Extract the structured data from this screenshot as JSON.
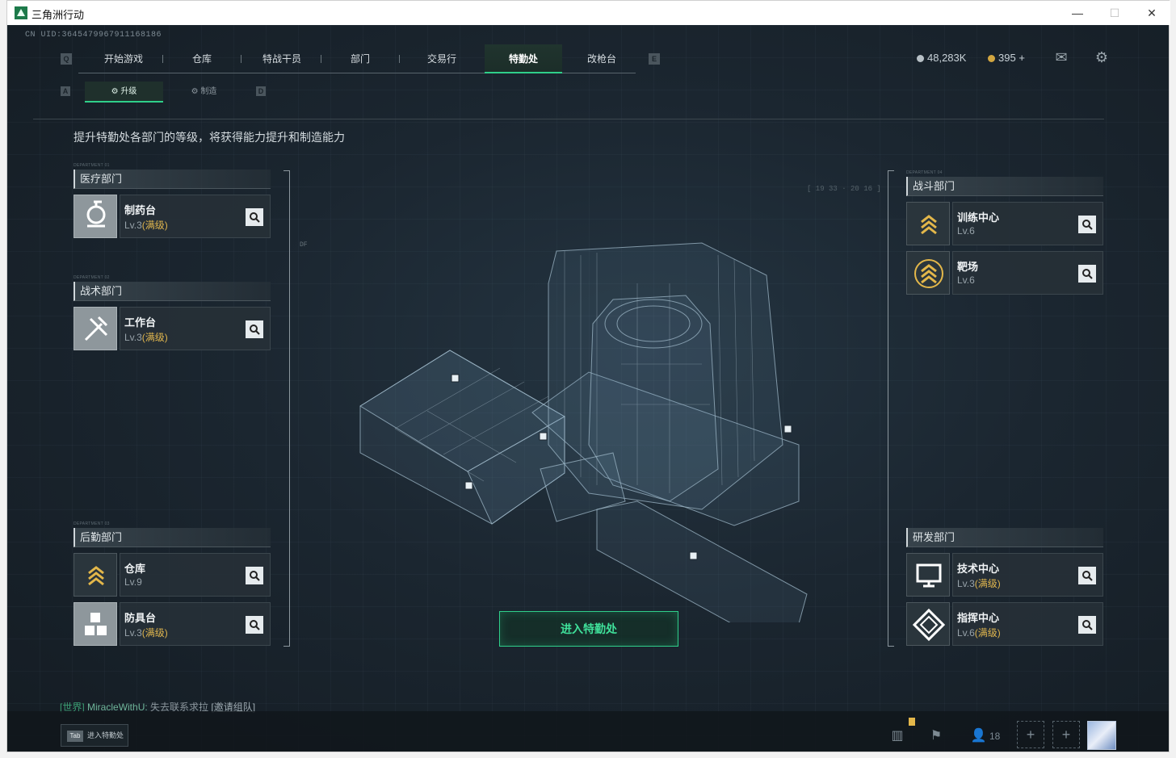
{
  "window": {
    "title": "三角洲行动",
    "minimize": "—",
    "maximize": "☐",
    "close": "✕"
  },
  "uid": "CN UID:3645479967911168186",
  "nav": {
    "key_left": "Q",
    "key_right": "E",
    "tabs": [
      "开始游戏",
      "仓库",
      "特战干员",
      "部门",
      "交易行",
      "特勤处",
      "改枪台"
    ],
    "active": "特勤处"
  },
  "currency": {
    "coins": "48,283K",
    "tickets": "395",
    "tickets_add": "+"
  },
  "subtabs": {
    "key_left": "A",
    "key_right": "D",
    "upgrade": "升级",
    "craft": "制造"
  },
  "description": "提升特勤处各部门的等级，将获得能力提升和制造能力",
  "departments": {
    "medical": {
      "tag": "DEPARTMENT 01",
      "title": "医疗部门",
      "items": [
        {
          "name": "制药台",
          "level": "Lv.3",
          "max": "(满级)",
          "icon": "microscope-icon"
        }
      ]
    },
    "tactical": {
      "tag": "DEPARTMENT 02",
      "title": "战术部门",
      "items": [
        {
          "name": "工作台",
          "level": "Lv.3",
          "max": "(满级)",
          "icon": "hammer-icon"
        }
      ]
    },
    "logistics": {
      "tag": "DEPARTMENT 03",
      "title": "后勤部门",
      "items": [
        {
          "name": "仓库",
          "level": "Lv.9",
          "max": "",
          "icon": "chevron-rank-icon"
        },
        {
          "name": "防具台",
          "level": "Lv.3",
          "max": "(满级)",
          "icon": "boxes-icon"
        }
      ]
    },
    "combat": {
      "tag": "DEPARTMENT 04",
      "title": "战斗部门",
      "items": [
        {
          "name": "训练中心",
          "level": "Lv.6",
          "max": "",
          "icon": "rank-up-icon"
        },
        {
          "name": "靶场",
          "level": "Lv.6",
          "max": "",
          "icon": "rank-up-icon"
        }
      ]
    },
    "research": {
      "title": "研发部门",
      "items": [
        {
          "name": "技术中心",
          "level": "Lv.3",
          "max": "(满级)",
          "icon": "monitor-icon"
        },
        {
          "name": "指挥中心",
          "level": "Lv.6",
          "max": "(满级)",
          "icon": "compass-icon"
        }
      ]
    }
  },
  "hud": {
    "coords": "[ 19 33 · 20 16 ]",
    "df": "DF"
  },
  "enter_button": "进入特勤处",
  "chat": {
    "channel": "[世界]",
    "user": "MiracleWithU:",
    "message": "失去联系求拉",
    "link": "[邀请组队]"
  },
  "tab_hint": {
    "key": "Tab",
    "label": "进入特勤处"
  },
  "bottom": {
    "friends_count": "18"
  }
}
